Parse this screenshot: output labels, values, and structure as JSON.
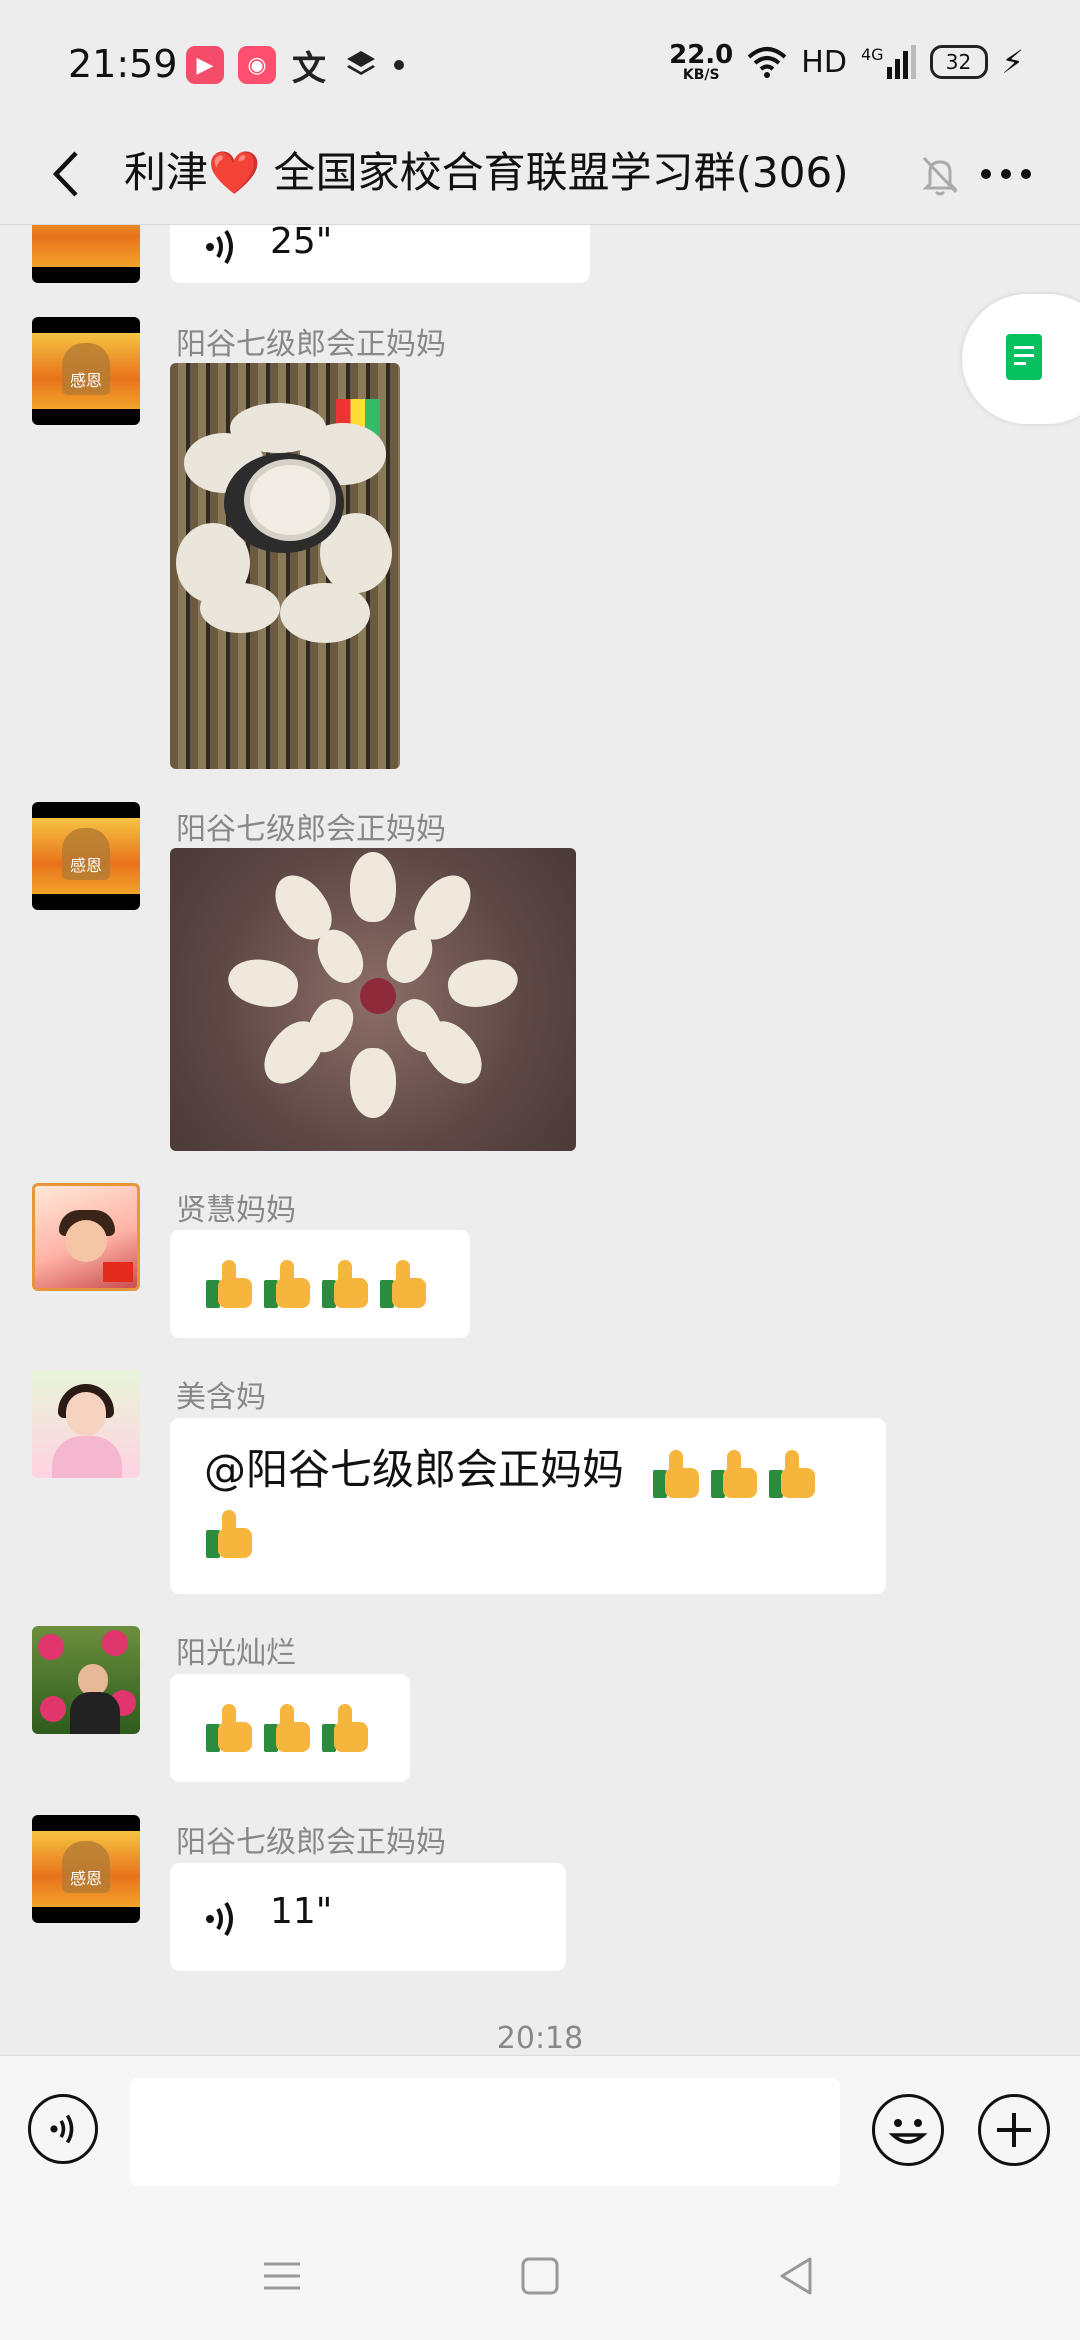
{
  "status_bar": {
    "time": "21:59",
    "apps": [
      "video-app-icon",
      "kuaishou-icon",
      "translate-icon",
      "layers-icon"
    ],
    "net_speed_value": "22.0",
    "net_speed_unit": "KB/S",
    "hd": "HD",
    "network": "4G",
    "battery": "32"
  },
  "header": {
    "title": "利津❤️ 全国家校合育联盟学习群(306)",
    "muted": true
  },
  "messages": [
    {
      "type": "voice",
      "duration": "25\""
    },
    {
      "sender": "阳谷七级郎会正妈妈",
      "type": "image"
    },
    {
      "sender": "阳谷七级郎会正妈妈",
      "type": "image"
    },
    {
      "sender": "贤慧妈妈",
      "type": "emoji",
      "thumbs": 4
    },
    {
      "sender": "美含妈",
      "type": "text",
      "mention": "@阳谷七级郎会正妈妈",
      "thumbs": 4
    },
    {
      "sender": "阳光灿烂",
      "type": "emoji",
      "thumbs": 3
    },
    {
      "sender": "阳谷七级郎会正妈妈",
      "type": "voice",
      "duration": "11\""
    }
  ],
  "avatar_text": "感恩",
  "timestamp": "20:18",
  "colors": {
    "background": "#ededed",
    "bubble": "#ffffff",
    "accent_green": "#07c160"
  }
}
